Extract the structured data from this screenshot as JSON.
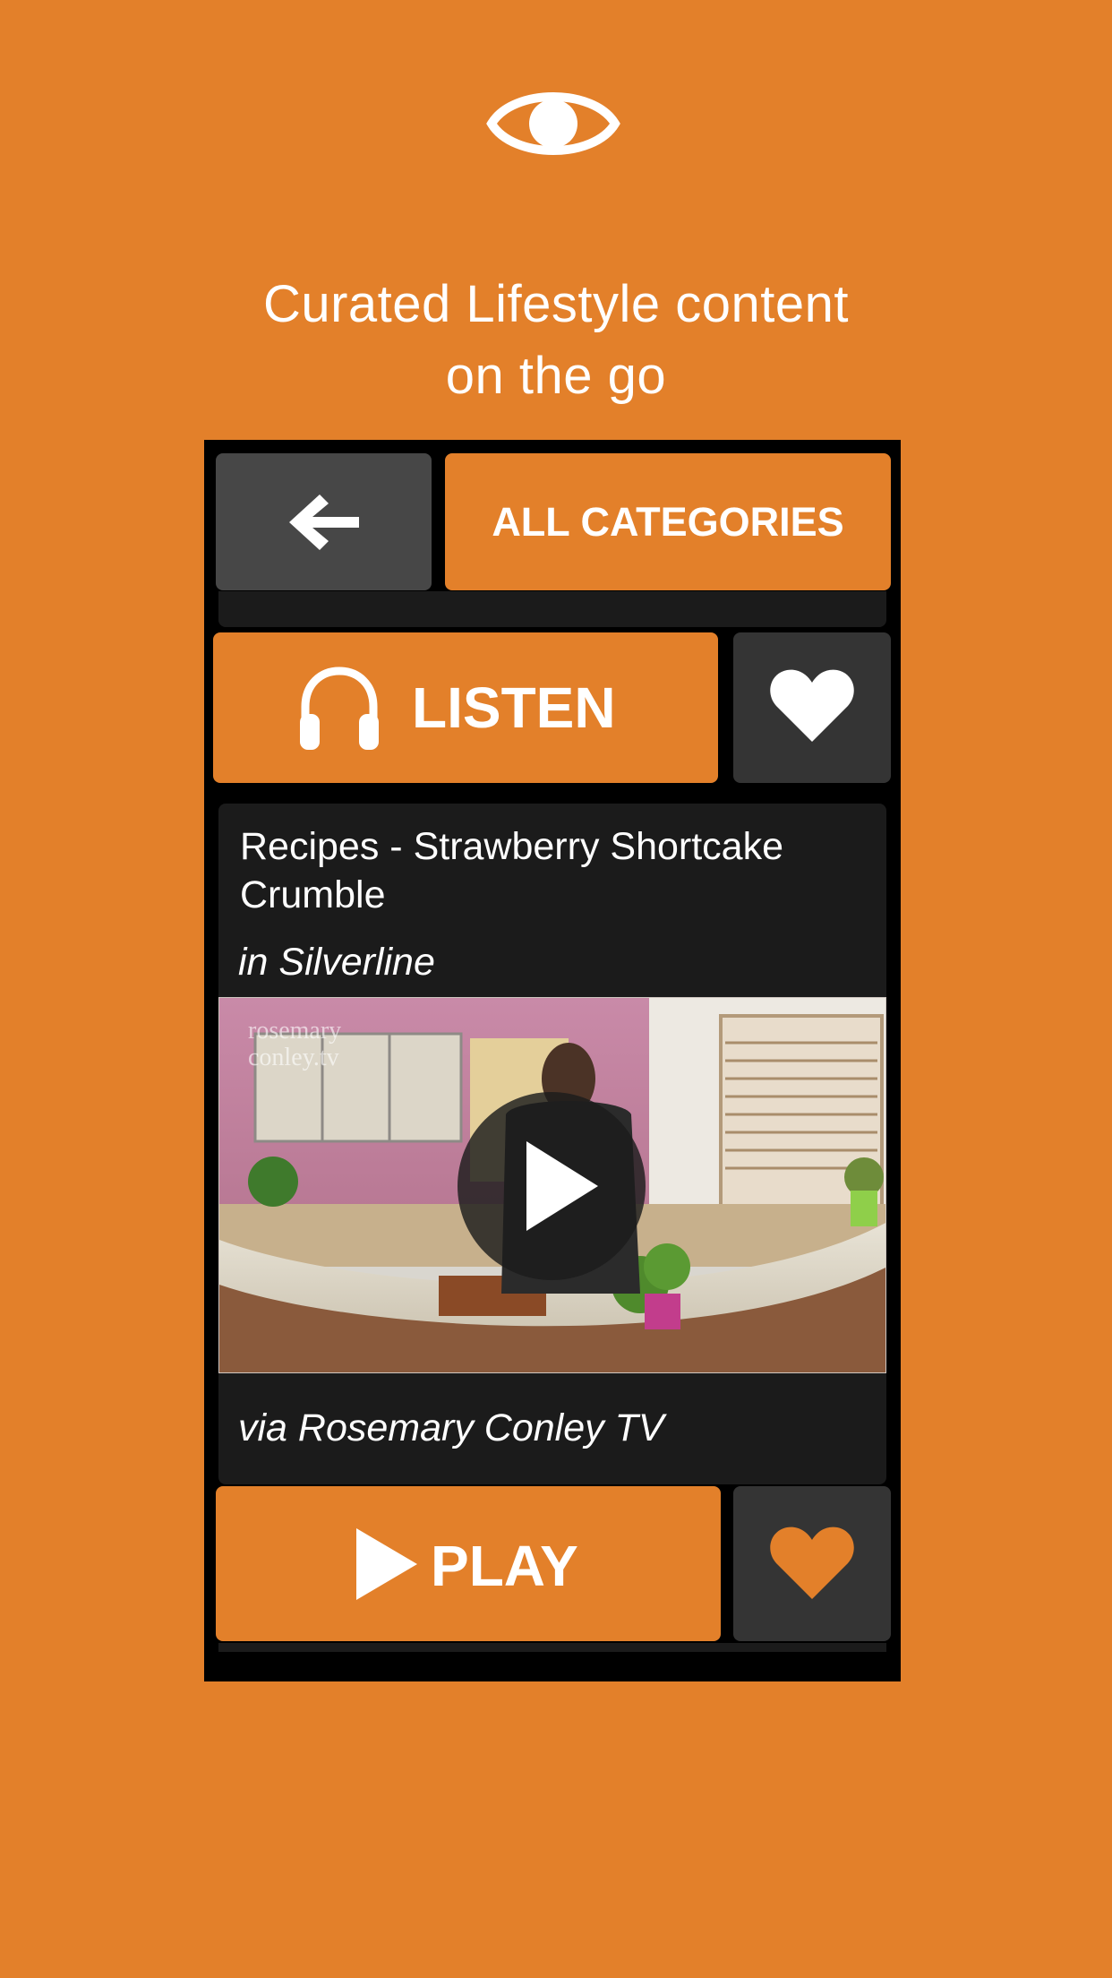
{
  "header": {
    "logo_icon": "eye-icon",
    "headline_line1": "Curated Lifestyle content",
    "headline_line2": "on the go"
  },
  "toolbar": {
    "back_icon": "arrow-left-icon",
    "categories_label": "ALL CATEGORIES"
  },
  "listen_row": {
    "listen_icon": "headphones-icon",
    "listen_label": "LISTEN",
    "favorite_icon": "heart-icon"
  },
  "card": {
    "title": "Recipes - Strawberry Shortcake Crumble",
    "category": "in Silverline",
    "thumbnail_watermark_line1": "rosemary",
    "thumbnail_watermark_line2": "conley.tv",
    "play_overlay_icon": "play-circle-icon",
    "source": "via Rosemary Conley TV"
  },
  "play_row": {
    "play_icon": "play-icon",
    "play_label": "PLAY",
    "favorite_icon": "heart-icon"
  },
  "colors": {
    "accent": "#E3802A",
    "dark_button": "#474747",
    "card_background": "#1B1B1B",
    "frame": "#000000",
    "favorite_button": "#343434"
  }
}
